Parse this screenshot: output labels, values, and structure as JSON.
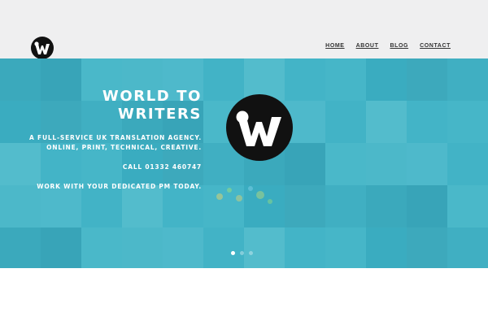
{
  "brand": {
    "logo_letter": "W",
    "color_dark": "#111111"
  },
  "nav": {
    "items": [
      {
        "label": "HOME"
      },
      {
        "label": "ABOUT"
      },
      {
        "label": "BLOG"
      },
      {
        "label": "CONTACT"
      }
    ]
  },
  "hero": {
    "headline_line1": "WORLD TO",
    "headline_line2": "WRITERS",
    "tagline_line1": "A FULL-SERVICE UK TRANSLATION AGENCY.",
    "tagline_line2": "ONLINE, PRINT, TECHNICAL, CREATIVE.",
    "call": "CALL 01332 460747",
    "cta": "WORK WITH YOUR DEDICATED PM TODAY.",
    "overlay_color": "#3ab0c4",
    "slider": {
      "total": 3,
      "active": 1
    }
  }
}
